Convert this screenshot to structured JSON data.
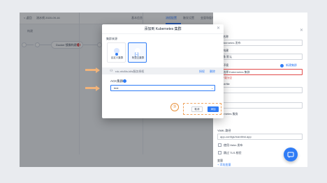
{
  "topbar": {
    "back": "< 返回",
    "pipeline_name": "流水线 2020-09-16",
    "tabs": [
      {
        "label": "基本信息"
      },
      {
        "label": "流程配置"
      },
      {
        "label": "触发设置"
      },
      {
        "label": "变量和缓存"
      }
    ],
    "publish": "保存并运行"
  },
  "canvas": {
    "stage_label": "构建",
    "node_label": "Docker 镜像构建"
  },
  "panel": {
    "labels": [
      "任务名称",
      "镜像构建",
      "Dockerfile",
      "标签",
      "Kubernetes 服务",
      "YAML 路径"
    ],
    "fields": [
      "Kubernetes 发布",
      "镜像 默认",
      "请选择 Kubernetes 集群",
      "",
      "",
      "app-configs/manifest.app"
    ],
    "error": "集群不能为空",
    "link": "新建集群",
    "checks": [
      "使用 Helm 发布",
      "跳过 TLS 校验"
    ],
    "section": "变量",
    "add_var": "+ 添加变量",
    "env_label": "所属环境"
  },
  "modal": {
    "title": "添加到 Kubernetes 集群",
    "source_label": "集群来源",
    "sources": [
      {
        "label": "自定义集群",
        "icon": "custom-cluster-icon"
      },
      {
        "label": "阿里云集群",
        "icon": "aliyun-cluster-icon",
        "selected": true
      }
    ],
    "account": "rdc-nfc8fa-k8s服务授权",
    "account_actions": [
      "授权",
      "删除"
    ],
    "ack_label": "ACK集群",
    "ack_value": "test",
    "cancel": "取消",
    "ok": "添加"
  },
  "annotation": {
    "step": "③"
  },
  "colors": {
    "accent": "#2f7cf6",
    "error": "#e24b4b",
    "callout": "#e8913b"
  }
}
